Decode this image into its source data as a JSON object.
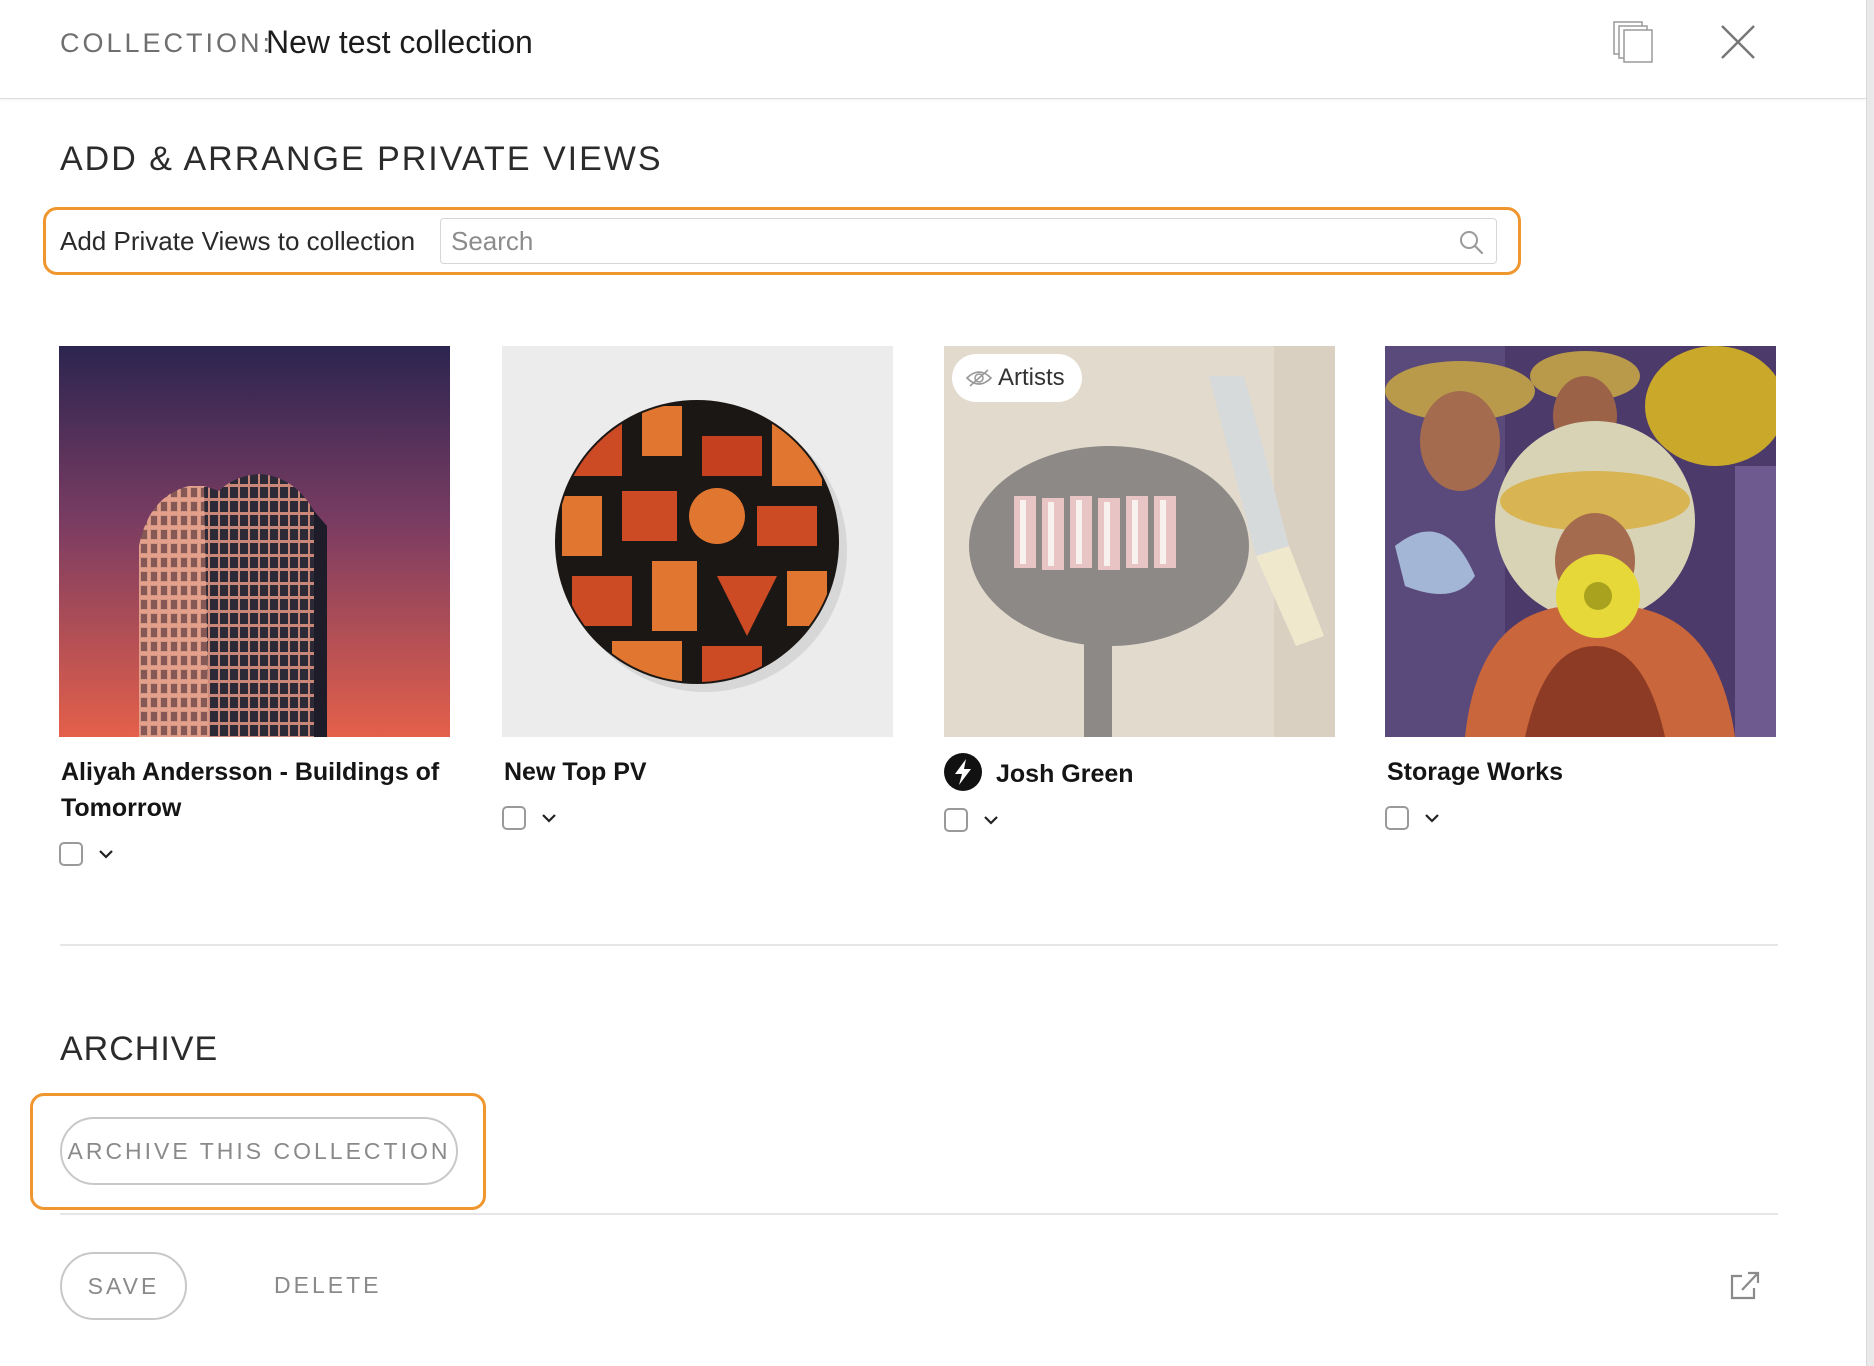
{
  "header": {
    "prefix": "COLLECTION:",
    "title": "New test collection"
  },
  "add_section": {
    "heading": "ADD & ARRANGE PRIVATE VIEWS",
    "search_label": "Add Private Views to collection",
    "search_placeholder": "Search",
    "highlight_color": "#f0962e"
  },
  "cards": [
    {
      "title": "Aliyah Andersson - Buildings of Tomorrow",
      "image": "skyscraper-photo"
    },
    {
      "title": "New Top PV",
      "image": "geometric-round-painting"
    },
    {
      "title": "Josh Green",
      "image": "bacon-skillet-photo",
      "badge": "Artists",
      "badge_icon": "eye-hidden-icon",
      "title_icon": "lightning-bolt-icon"
    },
    {
      "title": "Storage Works",
      "image": "trumpet-players-painting"
    }
  ],
  "archive_section": {
    "heading": "ARCHIVE",
    "button_label": "ARCHIVE THIS COLLECTION"
  },
  "footer": {
    "save_label": "SAVE",
    "delete_label": "DELETE"
  }
}
